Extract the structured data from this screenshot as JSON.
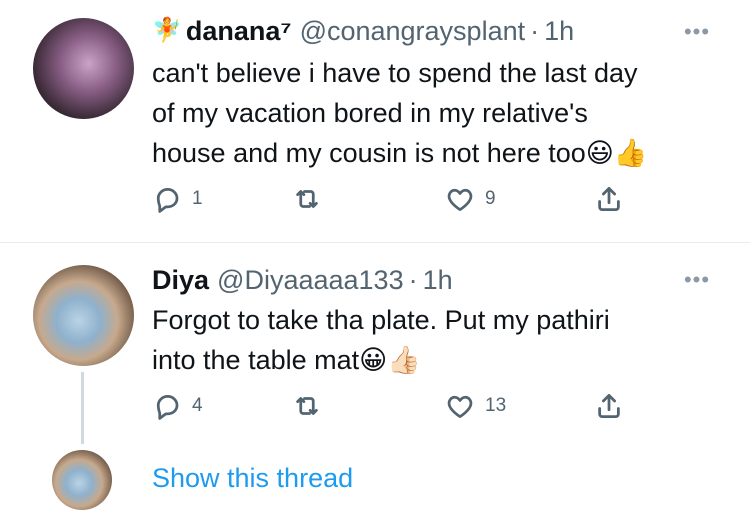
{
  "tweets": [
    {
      "fairy_emoji": "🧚",
      "name": "danana⁷",
      "handle": "@conangraysplant",
      "separator": "·",
      "time": "1h",
      "more_icon": "more-horizontal-icon",
      "lines": [
        "can't believe i have to spend the last day",
        "of my vacation bored in my relative's",
        "house and my cousin is not here too"
      ],
      "emoji_trail": "😃👍",
      "reply_count": "1",
      "retweet_count": "",
      "like_count": "9"
    },
    {
      "name": "Diya",
      "handle": "@Diyaaaaa133",
      "separator": "·",
      "time": "1h",
      "more_icon": "more-horizontal-icon",
      "lines": [
        "Forgot to take tha plate. Put my pathiri",
        "into the table mat"
      ],
      "emoji_trail": "😀👍🏻",
      "reply_count": "4",
      "retweet_count": "",
      "like_count": "13"
    }
  ],
  "thread": {
    "show_label": "Show this thread"
  },
  "colors": {
    "link": "#1d9bf0",
    "muted": "#536471",
    "divider": "#e6ecf0"
  }
}
